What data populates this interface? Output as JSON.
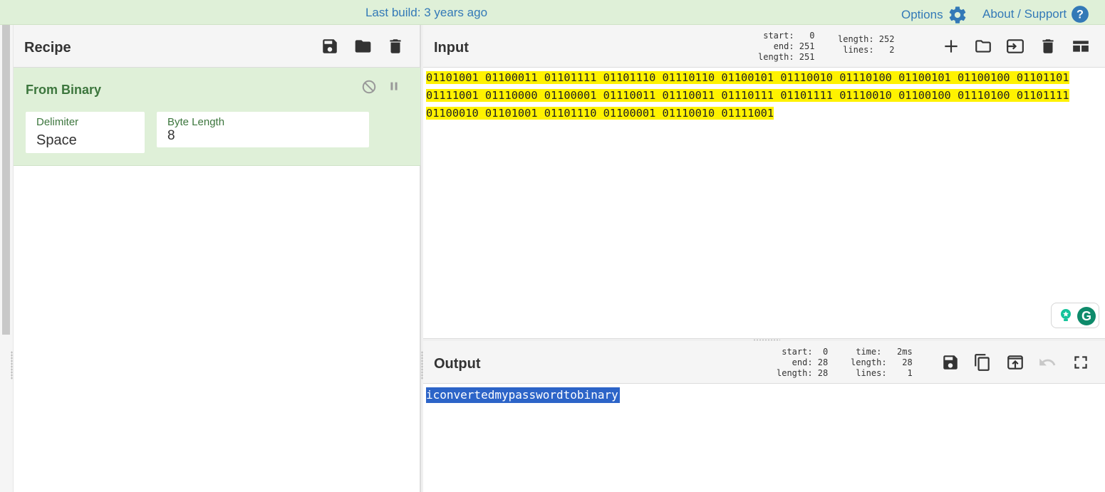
{
  "banner": {
    "build": "Last build: 3 years ago",
    "options_label": "Options",
    "support_label": "About / Support"
  },
  "recipe": {
    "title": "Recipe",
    "operation": {
      "name": "From Binary",
      "args": [
        {
          "label": "Delimiter",
          "value": "Space"
        },
        {
          "label": "Byte Length",
          "value": "8"
        }
      ]
    }
  },
  "input": {
    "title": "Input",
    "stats_left": [
      "start:   0",
      "end: 251",
      "length: 251"
    ],
    "stats_right": [
      "length: 252",
      "lines:   2"
    ],
    "lines": [
      "01101001 01100011 01101111 01101110 01110110 01100101 01110010 01110100 01100101 01100100 01101101",
      "01111001 01110000 01100001 01110011 01110011 01110111 01101111 01110010 01100100 01110100 01101111",
      "01100010 01101001 01101110 01100001 01110010 01111001"
    ]
  },
  "output": {
    "title": "Output",
    "stats_left": [
      "start:  0",
      "end: 28",
      "length: 28"
    ],
    "stats_right": [
      "time:   2ms",
      "length:   28",
      "lines:    1"
    ],
    "text": "iconvertedmypasswordtobinary"
  },
  "colors": {
    "accent": "#3379b7",
    "success_bg": "#dff0d8",
    "success_text": "#3c763d",
    "highlight": "#fff200",
    "selection": "#2c64c8"
  }
}
